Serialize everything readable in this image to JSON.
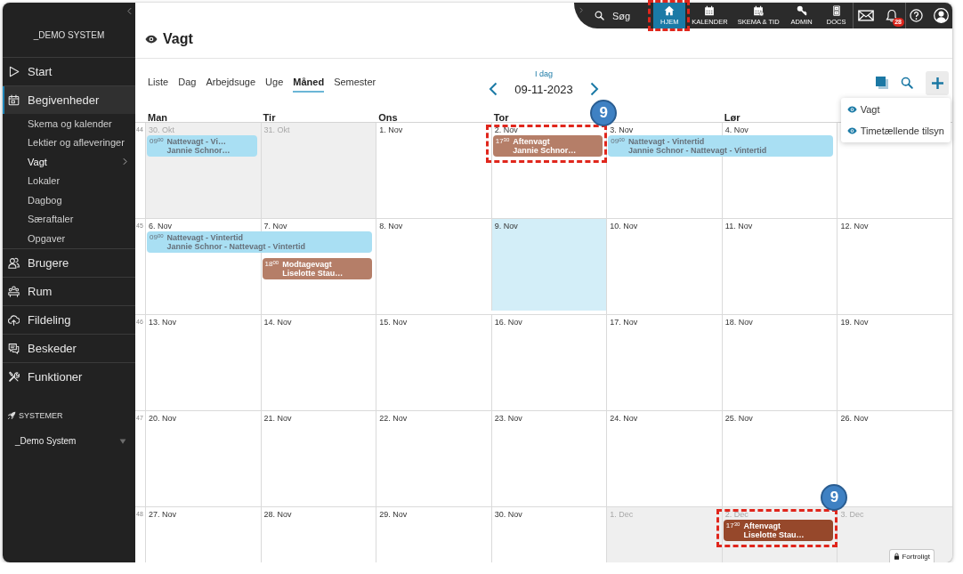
{
  "sidebar": {
    "org_name": "_DEMO SYSTEM",
    "items": [
      {
        "label": "Start",
        "selected": false
      },
      {
        "label": "Begivenheder",
        "selected": true,
        "expanded": true,
        "children": [
          {
            "label": "Skema og kalender",
            "selected": false
          },
          {
            "label": "Lektier og afleveringer",
            "selected": false
          },
          {
            "label": "Vagt",
            "selected": true
          },
          {
            "label": "Lokaler",
            "selected": false
          },
          {
            "label": "Dagbog",
            "selected": false
          },
          {
            "label": "Særaftaler",
            "selected": false
          },
          {
            "label": "Opgaver",
            "selected": false
          }
        ]
      },
      {
        "label": "Brugere",
        "selected": false
      },
      {
        "label": "Rum",
        "selected": false
      },
      {
        "label": "Fildeling",
        "selected": false
      },
      {
        "label": "Beskeder",
        "selected": false
      },
      {
        "label": "Funktioner",
        "selected": false
      }
    ],
    "section_title": "SYSTEMER",
    "system_select": {
      "value": "_Demo System"
    }
  },
  "topbar": {
    "search": {
      "label": "Søg"
    },
    "nav": [
      {
        "label": "HJEM",
        "selected": true,
        "highlighted": true
      },
      {
        "label": "KALENDER",
        "selected": false,
        "highlighted": false
      },
      {
        "label": "SKEMA & TID",
        "selected": false,
        "highlighted": false
      },
      {
        "label": "ADMIN",
        "selected": false,
        "highlighted": false
      },
      {
        "label": "DOCS",
        "selected": false,
        "highlighted": false
      }
    ],
    "notifications": {
      "count": "28"
    }
  },
  "page": {
    "title": "Vagt"
  },
  "toolbar": {
    "views": [
      {
        "label": "Liste",
        "selected": false
      },
      {
        "label": "Dag",
        "selected": false
      },
      {
        "label": "Arbejdsuge",
        "selected": false
      },
      {
        "label": "Uge",
        "selected": false
      },
      {
        "label": "Måned",
        "selected": true
      },
      {
        "label": "Semester",
        "selected": false
      }
    ],
    "today_link": "I dag",
    "date": "09-11-2023",
    "add_menu": {
      "open": true,
      "items": [
        {
          "label": "Vagt"
        },
        {
          "label": "Timetællende tilsyn"
        }
      ]
    }
  },
  "calendar": {
    "day_headers": {
      "mon": "Man",
      "tue": "Tir",
      "wed": "Ons",
      "thu": "Tor",
      "sat": "Lør"
    },
    "weeks": [
      {
        "number": "44",
        "days": [
          {
            "label": "30. Okt",
            "outside_month": true,
            "today": false,
            "events": [
              {
                "time": "09$^{00}$",
                "title": "Nattevagt - Vi…",
                "subtitle": "Jannie Schnor…",
                "color": "#a9dff3",
                "ends_next_day": false
              }
            ]
          },
          {
            "label": "31. Okt",
            "outside_month": true,
            "today": false
          },
          {
            "label": "1. Nov",
            "outside_month": false,
            "today": false
          },
          {
            "label": "2. Nov",
            "outside_month": false,
            "today": false,
            "events": [
              {
                "time": "17$^{30}$",
                "title": "Aftenvagt",
                "subtitle": "Jannie Schnor…",
                "color": "#b57e68",
                "ends_next_day": false,
                "callout": "9"
              }
            ]
          },
          {
            "label": "3. Nov",
            "outside_month": false,
            "today": false,
            "events": [
              {
                "time": "09$^{00}$",
                "title": "Nattevagt - Vintertid",
                "subtitle": "Jannie Schnor - Nattevagt - Vintertid",
                "color": "#a9dff3",
                "ends_next_day": true
              }
            ]
          },
          {
            "label": "4. Nov",
            "outside_month": false,
            "today": false
          },
          {
            "outside_month": false,
            "today": false
          }
        ]
      },
      {
        "number": "45",
        "days": [
          {
            "label": "6. Nov",
            "outside_month": false,
            "today": false,
            "events": [
              {
                "time": "09$^{00}$",
                "title": "Nattevagt - Vintertid",
                "subtitle": "Jannie Schnor - Nattevagt - Vintertid",
                "color": "#a9dff3",
                "ends_next_day": true
              }
            ]
          },
          {
            "label": "7. Nov",
            "outside_month": false,
            "today": false,
            "events": [
              {
                "time": "18$^{00}$",
                "title": "Modtagevagt",
                "subtitle": "Liselotte Stau…",
                "color": "#b57e68",
                "ends_next_day": false
              }
            ]
          },
          {
            "label": "8. Nov",
            "outside_month": false,
            "today": false
          },
          {
            "label": "9. Nov",
            "outside_month": false,
            "today": true
          },
          {
            "label": "10. Nov",
            "outside_month": false,
            "today": false
          },
          {
            "label": "11. Nov",
            "outside_month": false,
            "today": false
          },
          {
            "label": "12. Nov",
            "outside_month": false,
            "today": false
          }
        ]
      },
      {
        "number": "46",
        "days": [
          {
            "label": "13. Nov",
            "outside_month": false,
            "today": false
          },
          {
            "label": "14. Nov",
            "outside_month": false,
            "today": false
          },
          {
            "label": "15. Nov",
            "outside_month": false,
            "today": false
          },
          {
            "label": "16. Nov",
            "outside_month": false,
            "today": false
          },
          {
            "label": "17. Nov",
            "outside_month": false,
            "today": false
          },
          {
            "label": "18. Nov",
            "outside_month": false,
            "today": false
          },
          {
            "label": "19. Nov",
            "outside_month": false,
            "today": false
          }
        ]
      },
      {
        "number": "47",
        "days": [
          {
            "label": "20. Nov",
            "outside_month": false,
            "today": false
          },
          {
            "label": "21. Nov",
            "outside_month": false,
            "today": false
          },
          {
            "label": "22. Nov",
            "outside_month": false,
            "today": false
          },
          {
            "label": "23. Nov",
            "outside_month": false,
            "today": false
          },
          {
            "label": "24. Nov",
            "outside_month": false,
            "today": false
          },
          {
            "label": "25. Nov",
            "outside_month": false,
            "today": false
          },
          {
            "label": "26. Nov",
            "outside_month": false,
            "today": false
          }
        ]
      },
      {
        "number": "48",
        "days": [
          {
            "label": "27. Nov",
            "outside_month": false,
            "today": false
          },
          {
            "label": "28. Nov",
            "outside_month": false,
            "today": false
          },
          {
            "label": "29. Nov",
            "outside_month": false,
            "today": false
          },
          {
            "label": "30. Nov",
            "outside_month": false,
            "today": false
          },
          {
            "label": "1. Dec",
            "outside_month": true,
            "today": false
          },
          {
            "label": "2. Dec",
            "outside_month": true,
            "today": false,
            "events": [
              {
                "time": "17$^{30}$",
                "title": "Aftenvagt",
                "subtitle": "Liselotte Stau…",
                "color": "#96482b",
                "ends_next_day": false,
                "callout": "9"
              }
            ]
          },
          {
            "label": "3. Dec",
            "outside_month": true,
            "today": false
          }
        ]
      }
    ]
  },
  "confidential_badge": {
    "label": "Fortroligt"
  }
}
